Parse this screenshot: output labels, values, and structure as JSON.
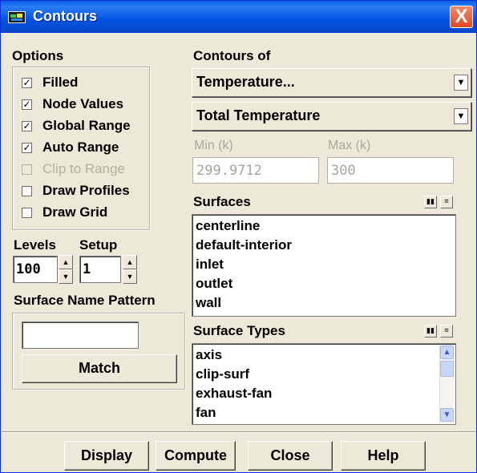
{
  "window": {
    "title": "Contours",
    "close_glyph": "X"
  },
  "options": {
    "title": "Options",
    "checkboxes": [
      {
        "label": "Filled",
        "checked": true,
        "enabled": true
      },
      {
        "label": "Node Values",
        "checked": true,
        "enabled": true
      },
      {
        "label": "Global Range",
        "checked": true,
        "enabled": true
      },
      {
        "label": "Auto Range",
        "checked": true,
        "enabled": true
      },
      {
        "label": "Clip to Range",
        "checked": false,
        "enabled": false
      },
      {
        "label": "Draw Profiles",
        "checked": false,
        "enabled": true
      },
      {
        "label": "Draw Grid",
        "checked": false,
        "enabled": true
      }
    ]
  },
  "levels": {
    "label": "Levels",
    "value": "100"
  },
  "setup": {
    "label": "Setup",
    "value": "1"
  },
  "surface_name_pattern": {
    "label": "Surface Name Pattern",
    "value": "",
    "match_label": "Match"
  },
  "contours_of": {
    "label": "Contours of",
    "category": "Temperature...",
    "quantity": "Total Temperature",
    "min_label": "Min (k)",
    "min_value": "299.9712",
    "max_label": "Max (k)",
    "max_value": "300"
  },
  "surfaces": {
    "label": "Surfaces",
    "items": [
      "centerline",
      "default-interior",
      "inlet",
      "outlet",
      "wall"
    ]
  },
  "surface_types": {
    "label": "Surface Types",
    "items": [
      "axis",
      "clip-surf",
      "exhaust-fan",
      "fan"
    ]
  },
  "buttons": {
    "display": "Display",
    "compute": "Compute",
    "close": "Close",
    "help": "Help"
  },
  "colors": {
    "titlebar": "#0a5fe8",
    "window_bg": "#ece9d8",
    "close_button": "#e14a20"
  }
}
